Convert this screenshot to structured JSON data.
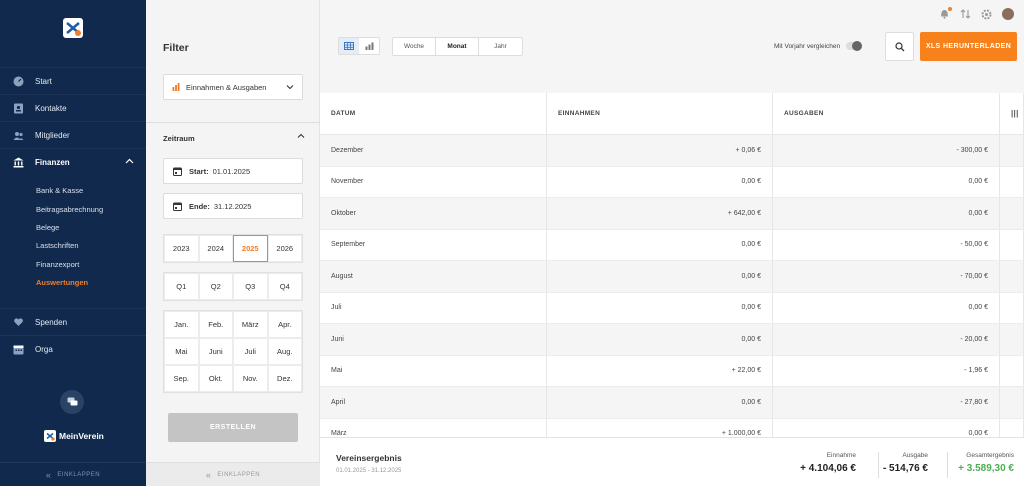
{
  "sidebar": {
    "nav": [
      {
        "label": "Start",
        "icon": "speedometer-icon"
      },
      {
        "label": "Kontakte",
        "icon": "contact-card-icon"
      },
      {
        "label": "Mitglieder",
        "icon": "people-icon"
      },
      {
        "label": "Finanzen",
        "icon": "bank-icon"
      }
    ],
    "finanzen_sub": [
      "Bank & Kasse",
      "Beitragsabrechnung",
      "Belege",
      "Lastschriften",
      "Finanzexport",
      "Auswertungen"
    ],
    "nav2": [
      {
        "label": "Spenden",
        "icon": "heart-hand-icon"
      },
      {
        "label": "Orga",
        "icon": "calendar-icon"
      }
    ],
    "brand": "MeinVerein",
    "collapse": "EINKLAPPEN"
  },
  "filter": {
    "title": "Filter",
    "select_value": "Einnahmen & Ausgaben",
    "zeitraum": "Zeitraum",
    "start_label": "Start:",
    "start_value": "01.01.2025",
    "end_label": "Ende:",
    "end_value": "31.12.2025",
    "years": [
      "2023",
      "2024",
      "2025",
      "2026"
    ],
    "quarters": [
      "Q1",
      "Q2",
      "Q3",
      "Q4"
    ],
    "months": [
      "Jan.",
      "Feb.",
      "März",
      "Apr.",
      "Mai",
      "Juni",
      "Juli",
      "Aug.",
      "Sep.",
      "Okt.",
      "Nov.",
      "Dez."
    ],
    "create": "ERSTELLEN",
    "collapse": "EINKLAPPEN"
  },
  "toolbar": {
    "periods": [
      "Woche",
      "Monat",
      "Jahr"
    ],
    "compare": "Mit Vorjahr vergleichen",
    "xls": "XLS HERUNTERLADEN"
  },
  "table": {
    "headers": [
      "DATUM",
      "EINNAHMEN",
      "AUSGABEN"
    ],
    "rows": [
      {
        "date": "Dezember",
        "in": "+ 0,06 €",
        "out": "- 300,00 €"
      },
      {
        "date": "November",
        "in": "0,00 €",
        "out": "0,00 €"
      },
      {
        "date": "Oktober",
        "in": "+ 642,00 €",
        "out": "0,00 €"
      },
      {
        "date": "September",
        "in": "0,00 €",
        "out": "- 50,00 €"
      },
      {
        "date": "August",
        "in": "0,00 €",
        "out": "- 70,00 €"
      },
      {
        "date": "Juli",
        "in": "0,00 €",
        "out": "0,00 €"
      },
      {
        "date": "Juni",
        "in": "0,00 €",
        "out": "- 20,00 €"
      },
      {
        "date": "Mai",
        "in": "+ 22,00 €",
        "out": "- 1,96 €"
      },
      {
        "date": "April",
        "in": "0,00 €",
        "out": "- 27,80 €"
      },
      {
        "date": "März",
        "in": "+ 1.000,00 €",
        "out": "0,00 €"
      }
    ]
  },
  "footer": {
    "title": "Vereinsergebnis",
    "range": "01.01.2025 - 31.12.2025",
    "einnahme_label": "Einnahme",
    "einnahme_value": "+ 4.104,06 €",
    "ausgabe_label": "Ausgabe",
    "ausgabe_value": "- 514,76 €",
    "gesamt_label": "Gesamtergebnis",
    "gesamt_value": "+ 3.589,30 €"
  },
  "colors": {
    "accent": "#f7821b",
    "sidebar": "#10294d",
    "positive": "#4caf50"
  }
}
